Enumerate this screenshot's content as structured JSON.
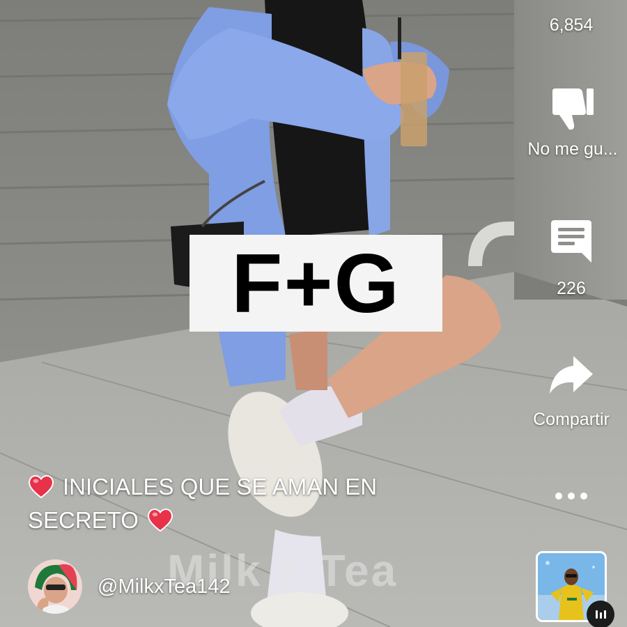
{
  "video": {
    "initials": "F+G",
    "caption_line1": "INICIALES QUE SE AMAN EN",
    "caption_line2": "SECRETO",
    "watermark": "Milk x Tea",
    "caption_icon": "heart-emoji"
  },
  "actions": {
    "likes_count": "6,854",
    "dislike_label": "No me gu...",
    "comments_count": "226",
    "share_label": "Compartir",
    "more_icon": "more-dots-icon",
    "dislike_icon": "thumbs-down-icon",
    "comment_icon": "comment-icon",
    "share_icon": "share-arrow-icon"
  },
  "channel": {
    "handle": "@MilkxTea142",
    "avatar_icon": "channel-avatar"
  },
  "sound": {
    "thumbnail_icon": "sound-thumbnail",
    "badge_icon": "audio-badge-icon"
  },
  "colors": {
    "heart": "#e8324a",
    "text": "#ffffff",
    "initials_box": "#f4f4f4",
    "jacket": "#7f9ee3"
  }
}
